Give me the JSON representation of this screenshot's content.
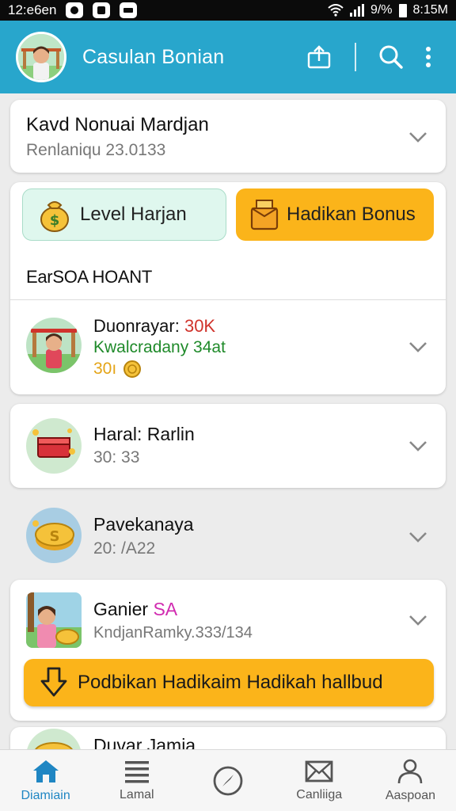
{
  "status_bar": {
    "time_left": "12:e6en",
    "signal_text": "9/%",
    "time_right": "8:15M"
  },
  "app_bar": {
    "title": "Casulan Bonian",
    "icons": [
      "share-icon",
      "search-icon",
      "more-vert-icon"
    ]
  },
  "profile_card": {
    "name": "Kavd Nonuai Mardjan",
    "subtitle": "Renlaniqu 23.0133"
  },
  "actions": {
    "level_label": "Level Harjan",
    "bonus_label": "Hadikan Bonus"
  },
  "section": {
    "heading": "EarSOA HOANT"
  },
  "items": [
    {
      "title": "Duonrayar: ",
      "title_accent": "30K",
      "subtitle": "Kwalcradany 34at",
      "coins": "30ı",
      "thumb": "child-park-icon"
    },
    {
      "title": "Haral: Rarlin",
      "subtitle": "30: 33",
      "thumb": "gift-box-icon"
    },
    {
      "title": "Pavekanaya",
      "subtitle": "20: /A22",
      "thumb": "coin-icon"
    },
    {
      "title": "Ganier ",
      "title_accent": "SA",
      "subtitle": "KndjanRamky.333/134",
      "thumb": "girl-coins-icon"
    }
  ],
  "promo_button": {
    "label": "Podbikan Hadikaim Hadikah hallbud"
  },
  "partial_item": {
    "title": "Duvar Jamia"
  },
  "colors": {
    "app_bar": "#28a6cc",
    "level_pill": "#dff7ee",
    "bonus_pill": "#fbb41a",
    "accent_red": "#d0332c",
    "accent_green": "#1f8a2a",
    "accent_magenta": "#d12bb0",
    "nav_active": "#1f86c3"
  },
  "bottom_nav": [
    {
      "label": "Diamiain",
      "icon": "home-icon",
      "active": true
    },
    {
      "label": "Lamal",
      "icon": "list-icon",
      "active": false
    },
    {
      "label": "",
      "icon": "compass-icon",
      "active": false
    },
    {
      "label": "Canliiga",
      "icon": "mail-icon",
      "active": false
    },
    {
      "label": "Aaspoan",
      "icon": "person-icon",
      "active": false
    }
  ]
}
